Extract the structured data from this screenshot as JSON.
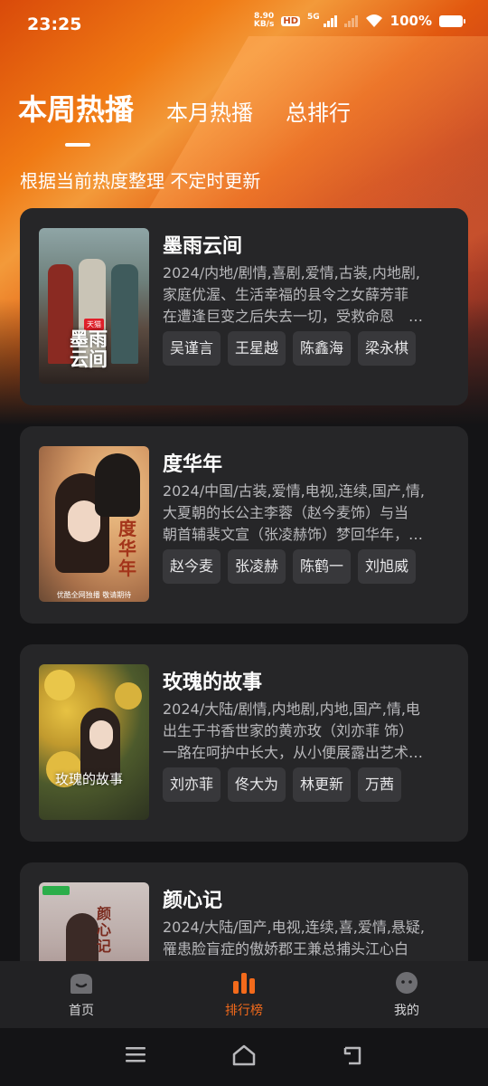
{
  "status": {
    "time": "23:25",
    "net_speed_value": "8.90",
    "net_speed_unit": "KB/s",
    "hd": "HD",
    "network": "5G",
    "battery": "100%"
  },
  "tabs": [
    {
      "label": "本周热播",
      "active": true
    },
    {
      "label": "本月热播",
      "active": false
    },
    {
      "label": "总排行",
      "active": false
    }
  ],
  "subtitle": "根据当前热度整理 不定时更新",
  "dramas": [
    {
      "title": "墨雨云间",
      "meta": "2024/内地/剧情,喜剧,爱情,古装,内地剧,",
      "desc_1": "家庭优渥、生活幸福的县令之女薛芳菲",
      "desc_2": "在遭逢巨变之后失去一切，受救命恩　…",
      "poster_text": "墨雨\n云间",
      "poster_badge": "天猫",
      "actors": [
        "吴谨言",
        "王星越",
        "陈鑫海",
        "梁永棋"
      ]
    },
    {
      "title": "度华年",
      "meta": "2024/中国/古装,爱情,电视,连续,国产,情,",
      "desc_1": "大夏朝的长公主李蓉（赵今麦饰）与当",
      "desc_2": "朝首辅裴文宣（张凌赫饰）梦回华年，…",
      "poster_text": "度华年",
      "poster_caption": "优酷全网独播 敬请期待",
      "actors": [
        "赵今麦",
        "张凌赫",
        "陈鹤一",
        "刘旭威"
      ]
    },
    {
      "title": "玫瑰的故事",
      "meta": "2024/大陆/剧情,内地剧,内地,国产,情,电",
      "desc_1": "出生于书香世家的黄亦玫（刘亦菲 饰）",
      "desc_2": "一路在呵护中长大，从小便展露出艺术…",
      "poster_text": "玫瑰的故事",
      "actors": [
        "刘亦菲",
        "佟大为",
        "林更新",
        "万茜"
      ]
    },
    {
      "title": "颜心记",
      "meta": "2024/大陆/国产,电视,连续,喜,爱情,悬疑,",
      "desc_1": "罹患脸盲症的傲娇郡王兼总捕头江心白",
      "desc_2": "",
      "poster_text": "颜心记",
      "actors": []
    }
  ],
  "nav": [
    {
      "label": "首页",
      "icon": "home-icon",
      "active": false
    },
    {
      "label": "排行榜",
      "icon": "ranking-icon",
      "active": true
    },
    {
      "label": "我的",
      "icon": "profile-icon",
      "active": false
    }
  ],
  "colors": {
    "accent": "#f26a1b",
    "card": "#262628",
    "background": "#141416"
  }
}
